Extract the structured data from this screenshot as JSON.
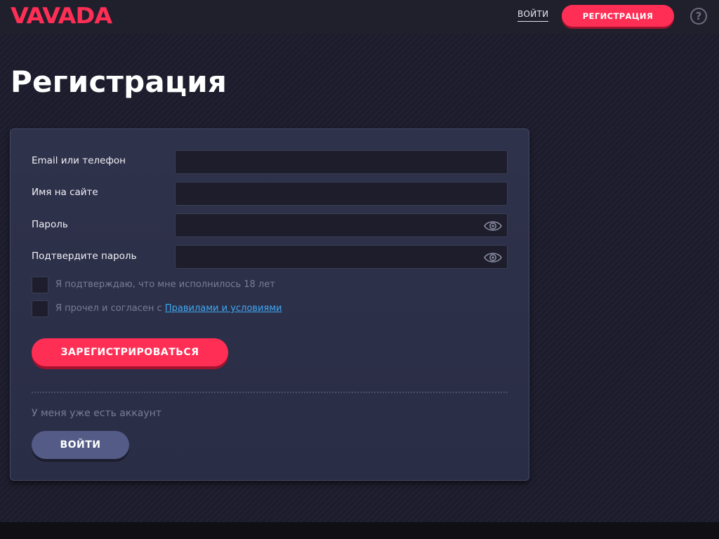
{
  "header": {
    "logo_text": "VAVADA",
    "login_link": "ВОЙТИ",
    "register_button": "РЕГИСТРАЦИЯ",
    "help_icon": "?"
  },
  "page": {
    "title": "Регистрация"
  },
  "form": {
    "fields": [
      {
        "label": "Email или телефон",
        "value": "",
        "placeholder": ""
      },
      {
        "label": "Имя на сайте",
        "value": "",
        "placeholder": ""
      },
      {
        "label": "Пароль",
        "value": "",
        "placeholder": "",
        "icon": "eye-icon"
      },
      {
        "label": "Подтвердите пароль",
        "value": "",
        "placeholder": "",
        "icon": "eye-icon"
      }
    ],
    "age_confirm": "Я подтверждаю, что мне исполнилось 18 лет",
    "terms_prefix": "Я прочел и согласен с ",
    "terms_link": "Правилами и условиями",
    "submit_button": "ЗАРЕГИСТРИРОВАТЬСЯ",
    "have_account_text": "У меня уже есть аккаунт",
    "login_button": "ВОЙТИ"
  },
  "colors": {
    "accent": "#ff2e55",
    "link": "#3fa9f5",
    "secondary_button": "#535b86",
    "background": "#1c1c2c"
  }
}
